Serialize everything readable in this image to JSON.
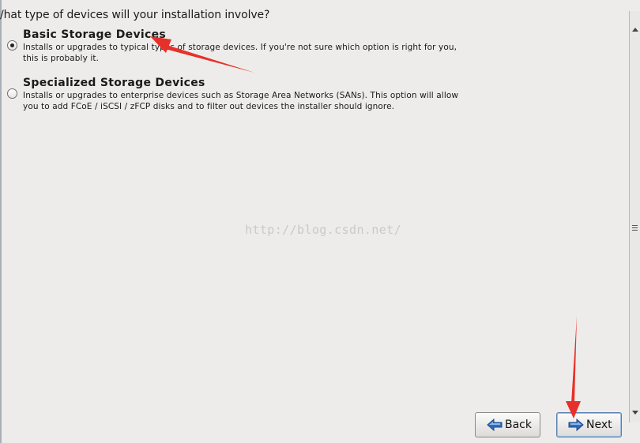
{
  "window": {
    "question": "/hat type of devices will your installation involve?"
  },
  "options": [
    {
      "title": "Basic Storage Devices",
      "description": "Installs or upgrades to typical types of storage devices.  If you're not sure which option is right for you,\nthis is probably it.",
      "selected": true
    },
    {
      "title": "Specialized Storage Devices",
      "description": "Installs or upgrades to enterprise devices such as Storage Area Networks (SANs). This option will allow\nyou to add FCoE / iSCSI / zFCP disks and to filter out devices the installer should ignore.",
      "selected": false
    }
  ],
  "watermark": "http://blog.csdn.net/",
  "buttons": {
    "back_label": "Back",
    "back_icon": "arrow-left-icon",
    "next_label": "Next",
    "next_icon": "arrow-right-icon"
  },
  "colors": {
    "annotation_arrow": "#e8302a",
    "button_arrow_blue": "#2f6dbd",
    "background": "#edecea"
  }
}
